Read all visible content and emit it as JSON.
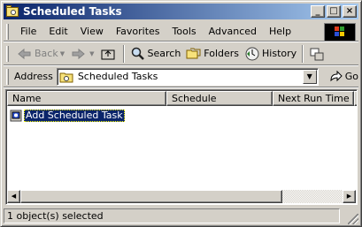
{
  "window": {
    "title": "Scheduled Tasks",
    "controls": {
      "minimize": "_",
      "maximize": "□",
      "close": "×"
    }
  },
  "menu": [
    "File",
    "Edit",
    "View",
    "Favorites",
    "Tools",
    "Advanced",
    "Help"
  ],
  "toolbar": {
    "back_label": "Back",
    "forward_label": "",
    "search_label": "Search",
    "folders_label": "Folders",
    "history_label": "History"
  },
  "address": {
    "label": "Address",
    "value": "Scheduled Tasks",
    "go_label": "Go"
  },
  "list": {
    "columns": [
      "Name",
      "Schedule",
      "Next Run Time"
    ],
    "items": [
      {
        "name": "Add Scheduled Task",
        "icon": "add-scheduled-task-icon"
      }
    ]
  },
  "status": {
    "text": "1 object(s) selected"
  },
  "colors": {
    "title_start": "#0a246a",
    "title_end": "#a6caf0",
    "selection": "#0a246a",
    "face": "#d4d0c8"
  }
}
